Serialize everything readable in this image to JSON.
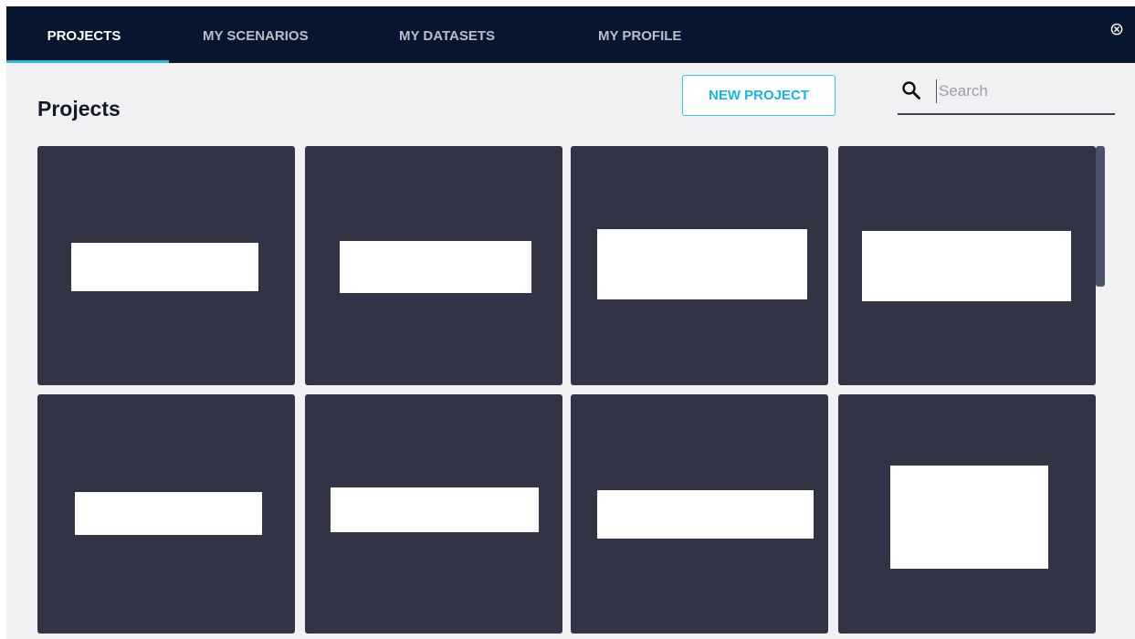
{
  "nav": {
    "tabs": [
      {
        "label": "PROJECTS",
        "active": true
      },
      {
        "label": "MY SCENARIOS",
        "active": false
      },
      {
        "label": "MY DATASETS",
        "active": false
      },
      {
        "label": "MY PROFILE",
        "active": false
      }
    ],
    "close_icon": "close-circle-icon"
  },
  "page": {
    "title": "Projects",
    "new_project_label": "NEW PROJECT"
  },
  "search": {
    "placeholder": "Search",
    "value": "",
    "icon": "search-icon"
  },
  "projects": {
    "count": 8
  },
  "colors": {
    "nav_bg": "#07162f",
    "accent": "#15b5ec",
    "card_bg": "#323446",
    "page_bg": "#f1f1f3"
  }
}
